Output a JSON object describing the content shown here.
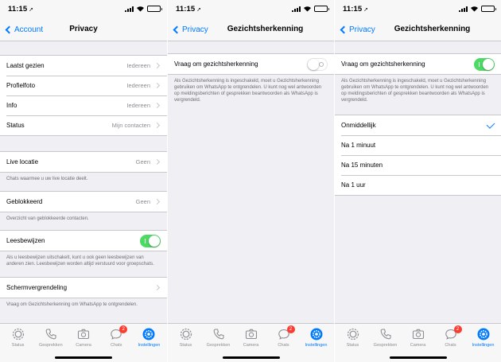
{
  "status_time": "11:15",
  "tabs": [
    {
      "label": "Status",
      "icon": "status-icon"
    },
    {
      "label": "Gesprekken",
      "icon": "phone-icon"
    },
    {
      "label": "Camera",
      "icon": "camera-icon"
    },
    {
      "label": "Chats",
      "icon": "chats-icon",
      "badge": "2"
    },
    {
      "label": "Instellingen",
      "icon": "settings-icon",
      "active": true
    }
  ],
  "colors": {
    "accent": "#007aff",
    "toggle_on": "#4cd964",
    "badge": "#ff3b30"
  },
  "screen1": {
    "back": "Account",
    "title": "Privacy",
    "last_seen": {
      "label": "Laatst gezien",
      "value": "Iedereen"
    },
    "profile_photo": {
      "label": "Profielfoto",
      "value": "Iedereen"
    },
    "info": {
      "label": "Info",
      "value": "Iedereen"
    },
    "status": {
      "label": "Status",
      "value": "Mijn contacten"
    },
    "live_location": {
      "label": "Live locatie",
      "value": "Geen"
    },
    "live_location_footer": "Chats waarmee u uw live locatie deelt.",
    "blocked": {
      "label": "Geblokkeerd",
      "value": "Geen"
    },
    "blocked_footer": "Overzicht van geblokkeerde contacten.",
    "read_receipts": {
      "label": "Leesbewijzen",
      "enabled": true
    },
    "read_receipts_footer": "Als u leesbewijzen uitschakelt, kunt u ook geen leesbewijzen van anderen zien. Leesbewijzen worden altijd verstuurd voor groepschats.",
    "screen_lock": {
      "label": "Schermvergrendeling"
    },
    "screen_lock_footer": "Vraag om Gezichtsherkenning om WhatsApp te ontgrendelen."
  },
  "screen2": {
    "back": "Privacy",
    "title": "Gezichtsherkenning",
    "toggle_label": "Vraag om gezichtsherkenning",
    "enabled": false,
    "footer": "Als Gezichtsherkenning is ingeschakeld, moet u Gezichtsherkenning gebruiken om WhatsApp te ontgrendelen. U kunt nog wel antwoorden op meldingsberichten of gesprekken beantwoorden als WhatsApp is vergrendeld."
  },
  "screen3": {
    "back": "Privacy",
    "title": "Gezichtsherkenning",
    "toggle_label": "Vraag om gezichtsherkenning",
    "enabled": true,
    "footer": "Als Gezichtsherkenning is ingeschakeld, moet u Gezichtsherkenning gebruiken om WhatsApp te ontgrendelen. U kunt nog wel antwoorden op meldingsberichten of gesprekken beantwoorden als WhatsApp is vergrendeld.",
    "options": [
      "Onmiddellijk",
      "Na 1 minuut",
      "Na 15 minuten",
      "Na 1 uur"
    ],
    "selected": "Onmiddellijk"
  }
}
